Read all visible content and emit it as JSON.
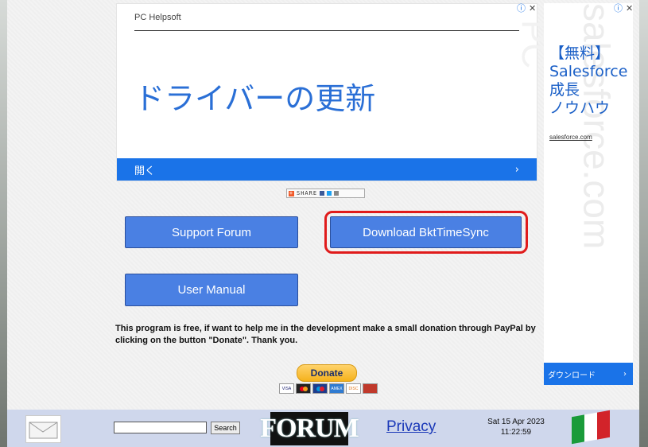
{
  "ad_top": {
    "brand": "PC Helpsoft",
    "headline": "ドライバーの更新",
    "cta": "開く",
    "watermark": "PC"
  },
  "ad_side": {
    "lines": [
      "【無料】",
      "Salesforce",
      "成長",
      "ノウハウ"
    ],
    "url": "salesforce.com",
    "cta": "ダウンロード",
    "watermark": "salesforce.com"
  },
  "share": {
    "label": "SHARE"
  },
  "buttons": {
    "support_forum": "Support Forum",
    "download": "Download BktTimeSync",
    "user_manual": "User Manual"
  },
  "notice": "This program is free, if want to help me in the development make a small donation through PayPal by clicking on the button \"Donate\". Thank you.",
  "donate": {
    "label": "Donate",
    "cards": [
      "VISA",
      "MC",
      "Maestro",
      "AMEX",
      "DISC",
      "BANK"
    ]
  },
  "footer": {
    "search_placeholder": "",
    "search_button": "Search",
    "forum_logo": "FORUM",
    "privacy": "Privacy",
    "date": "Sat 15 Apr 2023",
    "time": "11:22:59"
  },
  "colors": {
    "button_blue": "#4a80e3",
    "highlight_red": "#e01b1b",
    "ad_blue": "#1a73e8"
  }
}
